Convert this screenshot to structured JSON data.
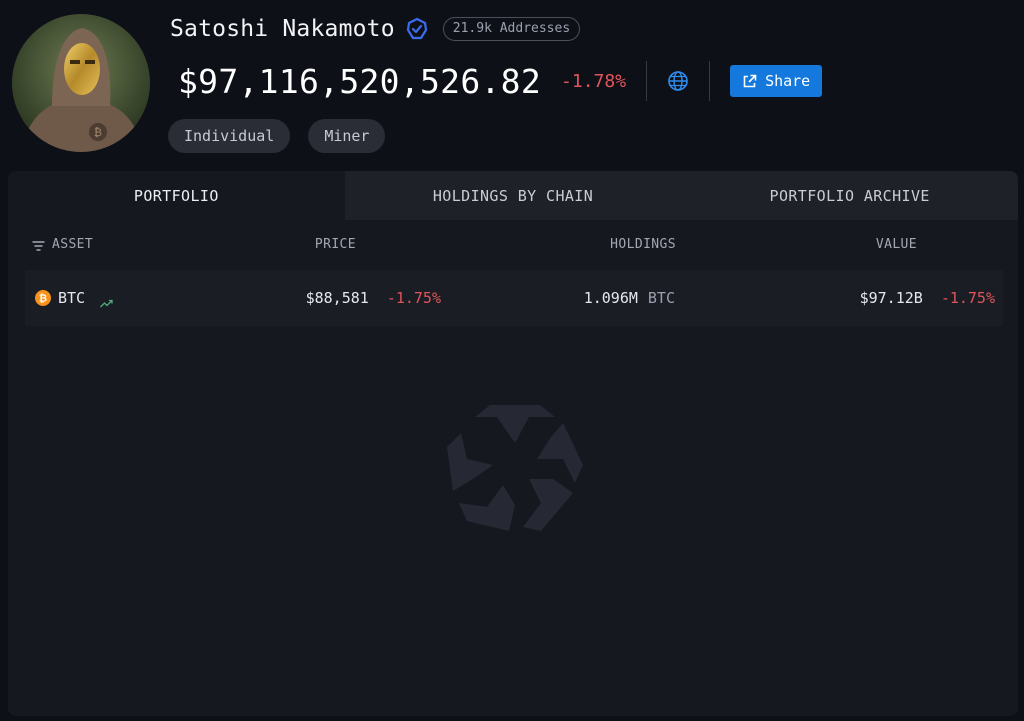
{
  "profile": {
    "name": "Satoshi Nakamoto",
    "addresses_badge": "21.9k Addresses",
    "total_value": "$97,116,520,526.82",
    "total_change": "-1.78%",
    "share_label": "Share",
    "tags": [
      "Individual",
      "Miner"
    ]
  },
  "tabs": [
    {
      "label": "PORTFOLIO",
      "active": true
    },
    {
      "label": "HOLDINGS BY CHAIN",
      "active": false
    },
    {
      "label": "PORTFOLIO ARCHIVE",
      "active": false
    }
  ],
  "table": {
    "headers": {
      "asset": "ASSET",
      "price": "PRICE",
      "holdings": "HOLDINGS",
      "value": "VALUE"
    },
    "rows": [
      {
        "asset": "BTC",
        "price": "$88,581",
        "price_change": "-1.75%",
        "holdings": "1.096M",
        "holdings_unit": "BTC",
        "value": "$97.12B",
        "value_change": "-1.75%"
      }
    ]
  },
  "icons": {
    "verified": "verified-badge-icon",
    "globe": "globe-icon",
    "share": "external-link-icon",
    "sort": "filter-icon",
    "asset": "bitcoin-icon",
    "trend": "trend-up-icon",
    "watermark": "arkham-logo"
  },
  "colors": {
    "background": "#0e1018",
    "panel": "#161820",
    "accent": "#1478dc",
    "negative": "#e0555a",
    "verified": "#3b6cf0"
  }
}
